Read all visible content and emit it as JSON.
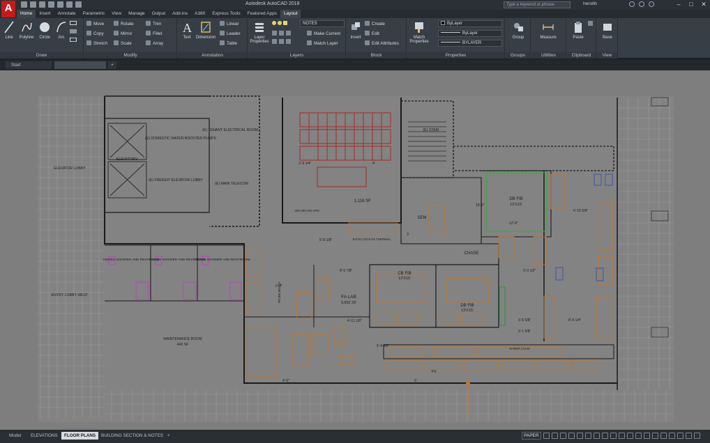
{
  "window": {
    "title": "Autodesk AutoCAD 2018",
    "search_placeholder": "Type a keyword or phrase",
    "user": "heroith"
  },
  "ribbon_tabs": [
    "Home",
    "Insert",
    "Annotate",
    "Parametric",
    "View",
    "Manage",
    "Output",
    "Add-ins",
    "A360",
    "Express Tools",
    "Featured Apps",
    "Layout"
  ],
  "ribbon": {
    "draw": {
      "title": "Draw",
      "line": "Line",
      "polyline": "Polyline",
      "circle": "Circle",
      "arc": "Arc"
    },
    "modify": {
      "title": "Modify",
      "move": "Move",
      "rotate": "Rotate",
      "trim": "Trim",
      "copy": "Copy",
      "mirror": "Mirror",
      "fillet": "Fillet",
      "stretch": "Stretch",
      "scale": "Scale",
      "array": "Array"
    },
    "annotation": {
      "title": "Annotation",
      "text": "Text",
      "dimension": "Dimension",
      "linear": "Linear",
      "leader": "Leader",
      "table": "Table"
    },
    "layers": {
      "title": "Layers",
      "layer_properties": "Layer Properties",
      "current_layer": "NOTES",
      "make_current": "Make Current",
      "match_layer": "Match Layer"
    },
    "block": {
      "title": "Block",
      "insert": "Insert",
      "create": "Create",
      "edit": "Edit",
      "edit_attributes": "Edit Attributes"
    },
    "properties": {
      "title": "Properties",
      "match_properties": "Match Properties",
      "color": "ByLayer",
      "linetype": "ByLayer",
      "lineweight": "BYLAYER"
    },
    "groups": {
      "title": "Groups",
      "group": "Group"
    },
    "utilities": {
      "title": "Utilities",
      "measure": "Measure"
    },
    "clipboard": {
      "title": "Clipboard",
      "paste": "Paste"
    },
    "view": {
      "title": "View",
      "base": "Base"
    }
  },
  "file_tabs": [
    "Start"
  ],
  "layout_tabs": [
    "Model",
    "ELEVATIONS",
    "FLOOR PLANS",
    "BUILDING SECTION & NOTES"
  ],
  "active_layout": "FLOOR PLANS",
  "status": {
    "space": "PAPER"
  },
  "plan_labels": {
    "elevator_lobby": "ELEVATOR LOBBY",
    "elevators": "ELEVATORS",
    "domestic": "(E) DOMESTIC WATER BOOSTER PUMPS",
    "tenant_elec": "(E) TENANT ELECTRICAL ROOM",
    "freight": "(E) FREIGHT ELEVATOR LOBBY",
    "main_telecom": "(E) MAIN TELECOM",
    "stair": "(E) STAIR",
    "area_1116": "1,116 SF",
    "ups": "200-250 KW UPS",
    "sem": "SEM",
    "db_fib_top": "DB FIB",
    "db_fib_top_size": "12'X15'",
    "chase": "CHASE",
    "elite": "ELITE LOCK-IN THERMAL",
    "cb_fib": "CB FIB",
    "cb_fib_size": "13'X15'",
    "db_fib_mid": "DB FIB",
    "db_fib_mid_size": "13'X15'",
    "fa_lab": "FA LAB",
    "fa_lab_area": "3,892 SF",
    "shower1": "UNISEX SHOWER AND RESTROOM",
    "shower2": "UNISEX SHOWER AND RESTROOM",
    "shower3": "UNISEX SHOWER AND RESTROOM",
    "entry_lobby": "ENTRY LOBBY WEST",
    "maintenance": "MAINTENANCE ROOM",
    "maintenance_area": "443 SF",
    "probe_bench": "PROBE BENCH",
    "d9000": "D-9000 CSAM",
    "fs": "FS",
    "dims": [
      "3'-9 1/4\"",
      "4'",
      "5'-8 1/8\"",
      "8'-5 7/8\"",
      "6'-8\"",
      "4'-11 1/8\"",
      "5'-4 3/8\"",
      "5'-6 5/8\"",
      "5'-1 5/8\"",
      "8'-4 1/4\"",
      "6'-10 5/8\"",
      "12'-8\"",
      "3'-3 1/2\"",
      "4'-6\"",
      "3'",
      "5'",
      "15'-2\""
    ]
  }
}
